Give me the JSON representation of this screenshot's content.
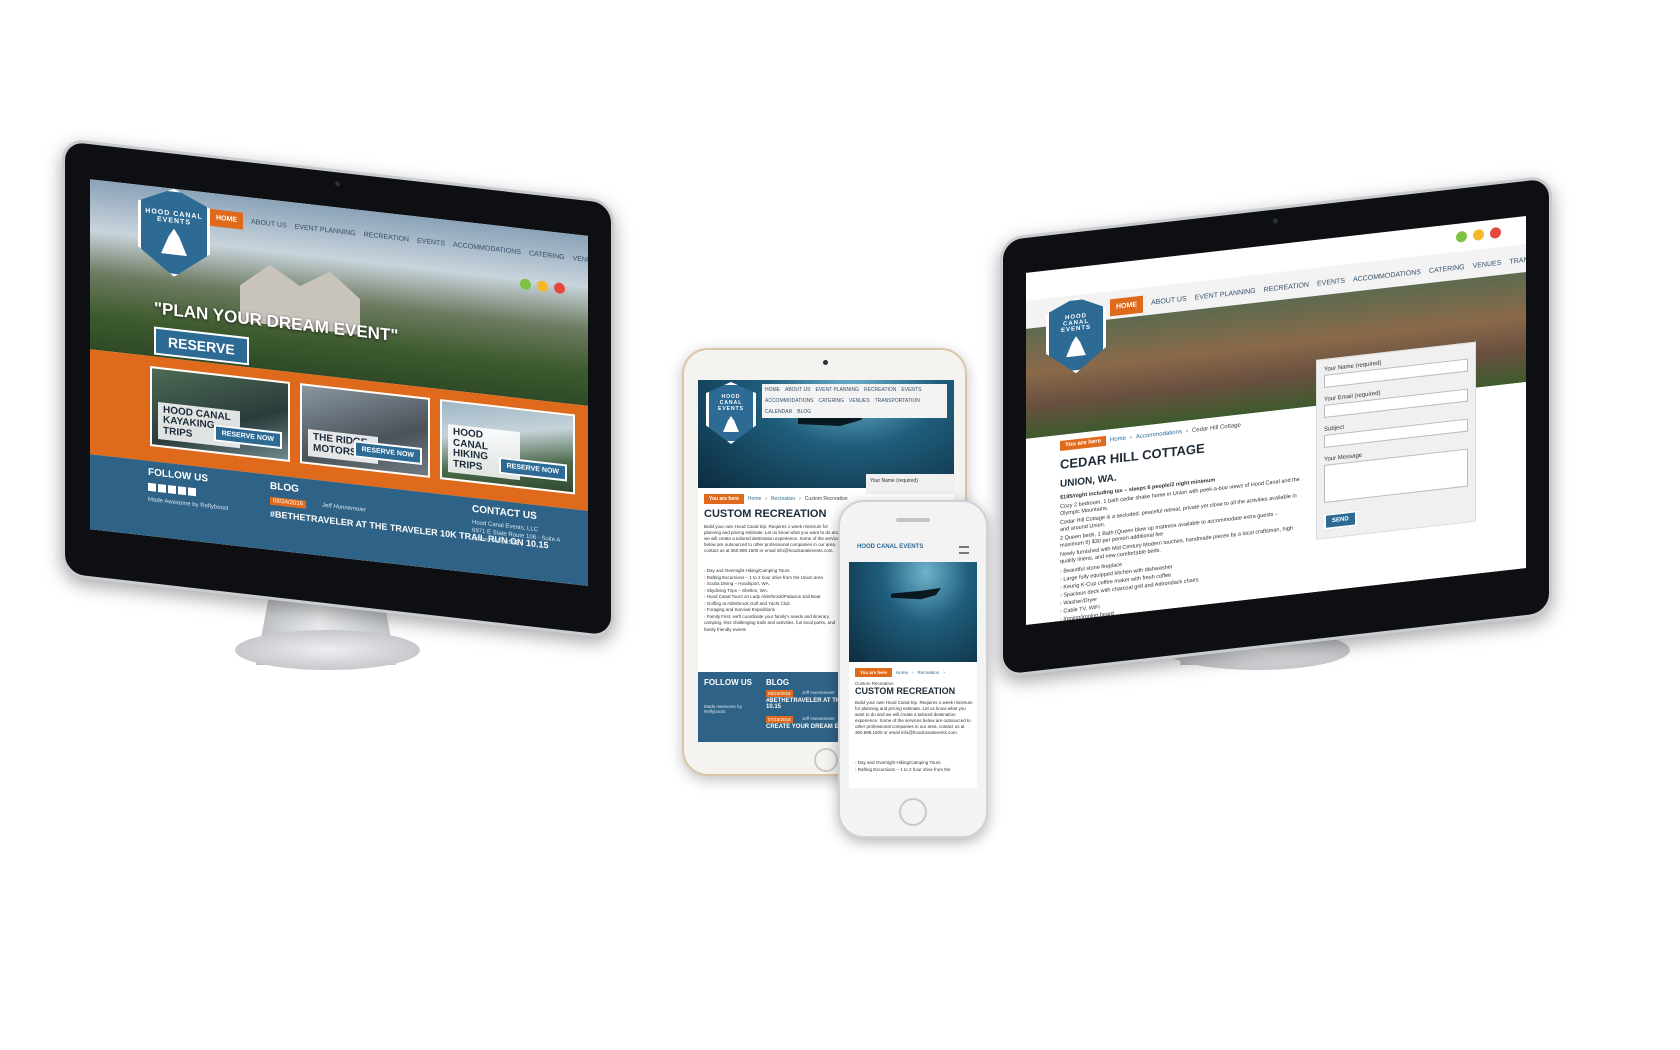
{
  "site": {
    "brand": "HOOD CANAL EVENTS",
    "nav": [
      "HOME",
      "ABOUT US",
      "EVENT PLANNING",
      "RECREATION",
      "EVENTS",
      "ACCOMMODATIONS",
      "CATERING",
      "VENUES",
      "TRANSPORTATION",
      "CALENDAR",
      "BLOG"
    ]
  },
  "left_monitor": {
    "hero_tagline": "\"PLAN YOUR DREAM EVENT\"",
    "reserve_label": "RESERVE",
    "cards": [
      {
        "title": "HOOD CANAL KAYAKING TRIPS",
        "button": "RESERVE NOW"
      },
      {
        "title": "THE RIDGE MOTORSPORTS",
        "button": "RESERVE NOW"
      },
      {
        "title": "HOOD CANAL HIKING TRIPS",
        "button": "RESERVE NOW"
      }
    ],
    "footer": {
      "follow_us": "FOLLOW US",
      "made_by": "Made Awesome by Reflyboost",
      "blog": "BLOG",
      "blog_date": "08/24/2016",
      "blog_author": "Jeff Hunnemeier",
      "blog_post": "#BETHETRAVELER AT THE TRAVELER 10K TRAIL RUN ON 10.15",
      "contact_us": "CONTACT US",
      "contact_name": "Hood Canal Events, LLC",
      "contact_address": "6971 E State Route 106 - Suite A",
      "contact_city": "Union, WA 98592"
    }
  },
  "tablet": {
    "you_are_here": "You are here",
    "bc_home": "Home",
    "bc_section": "Recreation",
    "bc_current": "Custom Recreation",
    "title": "CUSTOM RECREATION",
    "intro": "Build your own Hood Canal trip. Requires 1 week minimum for planning and pricing estimate. Let us know what you want to do and we will create a tailored destination experience. Some of the services below are outsourced to other professional companies in our area, contact us at 360.898.1500 or email info@hoodcanalevents.com.",
    "form_label": "Your Name (required)",
    "list": [
      "Day and Overnight Hiking/Camping Tours",
      "Rafting Excursions – 1 to 2 hour drive from the Union area",
      "Scuba Diving – Hoodsport, WA.",
      "Skydiving Trips – Shelton, WA.",
      "Hood Canal Tours on Lady Alderbrook/Palacios Sail Boat",
      "Golfing at Alderbrook Golf and Yacht Club",
      "Foraging and Survival Expeditions",
      "Family First, we'll coordinate your family's needs and itinerary, camping, less challenging trails and activities, fun local parks, and family friendly events"
    ],
    "follow_us": "FOLLOW US",
    "made_by": "Made Awesome by Reflyboost",
    "blog": "BLOG",
    "blog_date_1": "08/24/2016",
    "blog_author_1": "Jeff Hunnemeier",
    "blog_post_1": "#BETHETRAVELER AT THE TRAVELER 10K TRAIL RUN ON 10.15",
    "blog_date_2": "07/18/2016",
    "blog_author_2": "Jeff Hunnemeier",
    "blog_post_2": "CREATE YOUR DREAM EVENT"
  },
  "phone": {
    "brand": "HOOD CANAL EVENTS",
    "you_are_here": "You are here",
    "bc_home": "Home",
    "bc_section": "Recreation",
    "bc_current": "Custom Recreation",
    "title": "CUSTOM RECREATION",
    "intro": "Build your own Hood Canal trip. Requires 1 week minimum for planning and pricing estimate. Let us know what you want to do and we will create a tailored destination experience. Some of the services below are outsourced to other professional companies in our area, contact us at 360.898.1500 or email info@hoodcanalevents.com.",
    "list": [
      "Day and Overnight Hiking/Camping Tours",
      "Rafting Excursions – 1 to 2 hour drive from the"
    ]
  },
  "right_monitor": {
    "you_are_here": "You are here",
    "bc_home": "Home",
    "bc_section": "Accommodations",
    "bc_current": "Cedar Hill Cottage",
    "title": "CEDAR HILL COTTAGE",
    "subtitle": "UNION, WA.",
    "intro": "$185/night including tax – sleeps 6 people/2 night minimum",
    "paragraphs": [
      "Cozy 2 bedroom, 1 bath cedar shake home in Union with peek-a-boo views of Hood Canal and the Olympic Mountains.",
      "Cedar Hill Cottage is a secluded, peaceful retreat, private yet close to all the activities available in and around Union.",
      "2 Queen beds, 1 Bath (Queen blow up mattress available to accommodate extra guests – maximum 6) $30 per person additional fee",
      "Newly furnished with Mid Century Modern touches, handmade pieces by a local craftsman, high quality linens, and new comfortable beds."
    ],
    "amenities": [
      "Beautiful stone fireplace",
      "Large fully equipped kitchen with dishwasher",
      "Keurig K-Cup coffee maker with fresh coffee",
      "Spacious deck with charcoal grill and Adirondack chairs",
      "Washer/Dryer",
      "Cable TV, WiFi",
      "Ironing/ironing board"
    ],
    "form": {
      "name_label": "Your Name (required)",
      "email_label": "Your Email (required)",
      "subject_label": "Subject",
      "message_label": "Your Message",
      "send_label": "SEND"
    }
  },
  "colors": {
    "brand_blue": "#2d6b95",
    "brand_orange": "#e06a1c",
    "footer_blue": "#2f6287"
  }
}
